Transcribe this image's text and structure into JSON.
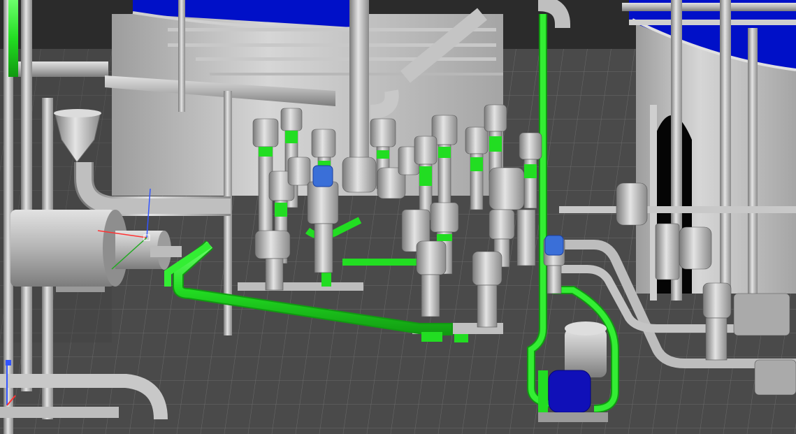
{
  "viewport": {
    "background": "#2f2f2f",
    "floor_color": "#4a4a4a",
    "floor_grid_color": "#6b6b6b",
    "wall_color": "#bdbdbd",
    "tank_fluid_color": "#0010c8",
    "steel_color": "#b4b4b4",
    "valve_body_color": "#9a9a9a",
    "highlight_pipe_color": "#22dd22",
    "actuator_cap_blue": "#3a6fd8",
    "pump_motor_blue": "#1010b8",
    "axis_x_color": "#ff3333",
    "axis_y_color": "#22aa22",
    "axis_z_color": "#3355ff"
  }
}
